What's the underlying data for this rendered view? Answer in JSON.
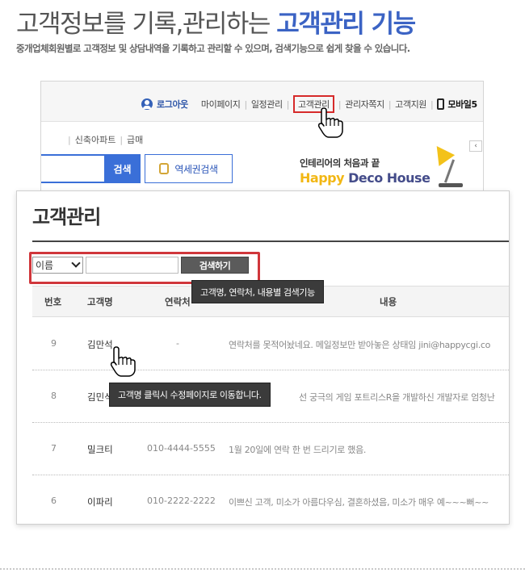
{
  "headline": {
    "prefix": "고객정보를 기록,관리하는 ",
    "accent": "고객관리 기능"
  },
  "subline": "중개업체회원별로 고객정보 및 상담내역을 기록하고 관리할 수 있으며, 검색기능으로 쉽게 찾을 수 있습니다.",
  "site": {
    "nav": {
      "logout": "로그아웃",
      "items": [
        "마이페이지",
        "일정관리",
        "고객관리",
        "관리자쪽지",
        "고객지원"
      ],
      "mobile": "모바일5"
    },
    "categories": [
      "신축아파트",
      "급매"
    ],
    "search_button": "검색",
    "station_button": "역세권검색",
    "banner_sub": "인테리어의 처음과 끝",
    "banner_title_a": "Happy",
    "banner_title_b": " Deco House",
    "collapse_glyph": "‹"
  },
  "panel": {
    "title": "고객관리",
    "search": {
      "selected": "이름",
      "query": "",
      "button": "검색하기"
    },
    "columns": [
      "번호",
      "고객명",
      "연락처",
      "내용"
    ],
    "rows": [
      {
        "num": "9",
        "name": "김만석",
        "phone": "-",
        "memo": "연락처를 못적어놨네요. 메일정보만 받아놓은 상태임 jini@happycgi.co"
      },
      {
        "num": "8",
        "name": "김민석",
        "phone": "",
        "memo": "선 궁극의 게임 포트리스R을 개발하신 개발자로 엄청난"
      },
      {
        "num": "7",
        "name": "밀크티",
        "phone": "010-4444-5555",
        "memo": "1월 20일에 연락 한 번 드리기로 했음."
      },
      {
        "num": "6",
        "name": "이파리",
        "phone": "010-2222-2222",
        "memo": "이쁘신 고객, 미소가 아름다우심, 결혼하셨음, 미소가 매우 예~~~뻐~~"
      }
    ],
    "tooltip_search": "고객명, 연락처, 내용별 검색기능",
    "tooltip_name": "고객명 클릭시 수정페이지로 이동합니다."
  },
  "colors": {
    "accent": "#3b63c4",
    "highlight": "#d0363b",
    "search_blue": "#3a6fd8",
    "tooltip": "#3b3b3b"
  }
}
